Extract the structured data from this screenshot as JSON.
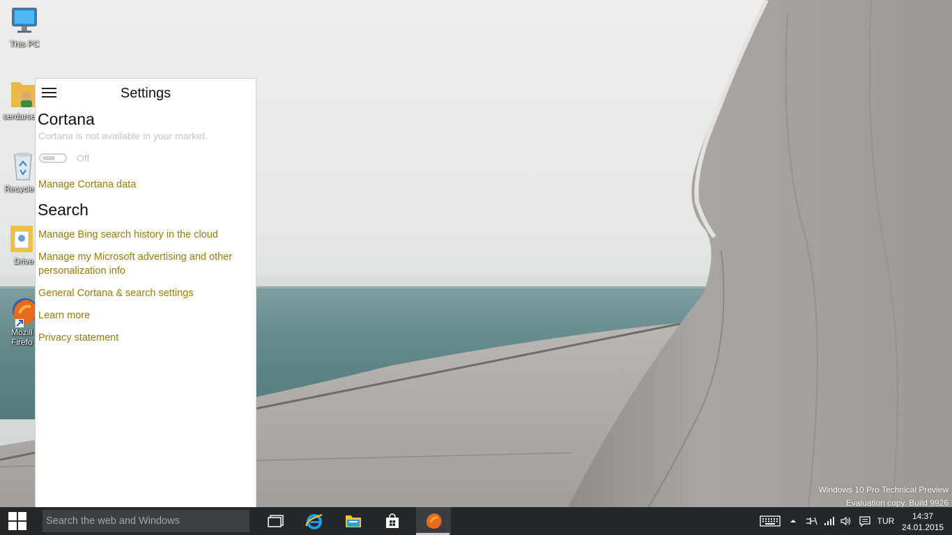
{
  "desktop": {
    "icons": [
      {
        "label": "This PC"
      },
      {
        "label": "serdarse"
      },
      {
        "label": "Recycle"
      },
      {
        "label": "Drive"
      },
      {
        "label": "Mozill",
        "label2": "Firefo"
      }
    ],
    "watermark": {
      "line1": "Windows 10 Pro Technical Preview",
      "line2": "Evaluation copy. Build 9926"
    }
  },
  "settings_panel": {
    "title": "Settings",
    "cortana": {
      "heading": "Cortana",
      "description": "Cortana is not available in your market.",
      "toggle_state": "Off",
      "manage_link": "Manage Cortana data"
    },
    "search": {
      "heading": "Search",
      "links": [
        "Manage Bing search history in the cloud",
        "Manage my Microsoft advertising and other personalization info",
        "General Cortana & search settings",
        "Learn more",
        "Privacy statement"
      ]
    }
  },
  "taskbar": {
    "search_placeholder": "Search the web and Windows",
    "apps": [
      {
        "icon": "task-view-icon"
      },
      {
        "icon": "internet-explorer-icon"
      },
      {
        "icon": "file-explorer-icon"
      },
      {
        "icon": "store-icon"
      },
      {
        "icon": "firefox-icon",
        "active": true
      }
    ],
    "tray": {
      "language": "TUR",
      "time": "14:37",
      "date": "24.01.2015"
    }
  },
  "colors": {
    "link": "#9b7b06",
    "taskbar": "#24282b",
    "searchbox": "#3c4044"
  }
}
